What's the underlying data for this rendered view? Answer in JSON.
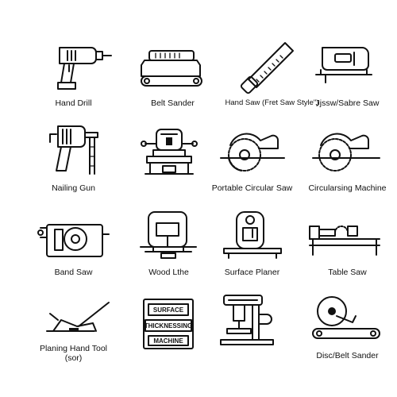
{
  "tools": [
    {
      "label": "Hand Drill",
      "icon": "hand-drill-icon"
    },
    {
      "label": "Belt Sander",
      "icon": "belt-sander-icon"
    },
    {
      "label": "Hand Saw (Fret Saw Style\")",
      "icon": "hand-saw-icon"
    },
    {
      "label": "Jjssw/Sabre Saw",
      "icon": "jigsaw-icon"
    },
    {
      "label": "Nailing Gun",
      "icon": "nailing-gun-icon"
    },
    {
      "label": "",
      "icon": "bench-machine-icon"
    },
    {
      "label": "Portable Circular Saw",
      "icon": "portable-circular-saw-icon"
    },
    {
      "label": "Circularsing Machine",
      "icon": "circular-saw-machine-icon"
    },
    {
      "label": "Band Saw",
      "icon": "band-saw-icon"
    },
    {
      "label": "Wood Lthe",
      "icon": "wood-lathe-icon"
    },
    {
      "label": "Surface Planer",
      "icon": "surface-planer-icon"
    },
    {
      "label": "Table Saw",
      "icon": "table-saw-icon"
    },
    {
      "label": "Planing Hand Tool",
      "label_line2": "(sor)",
      "icon": "planing-hand-tool-icon"
    },
    {
      "label": "",
      "icon": "thicknessing-machine-icon",
      "sign_lines": [
        "SURFACE",
        "THICKNESSING",
        "MACHINE"
      ]
    },
    {
      "label": "",
      "icon": "drill-press-icon"
    },
    {
      "label": "Disc/Belt Sander",
      "icon": "disc-belt-sander-icon"
    }
  ]
}
